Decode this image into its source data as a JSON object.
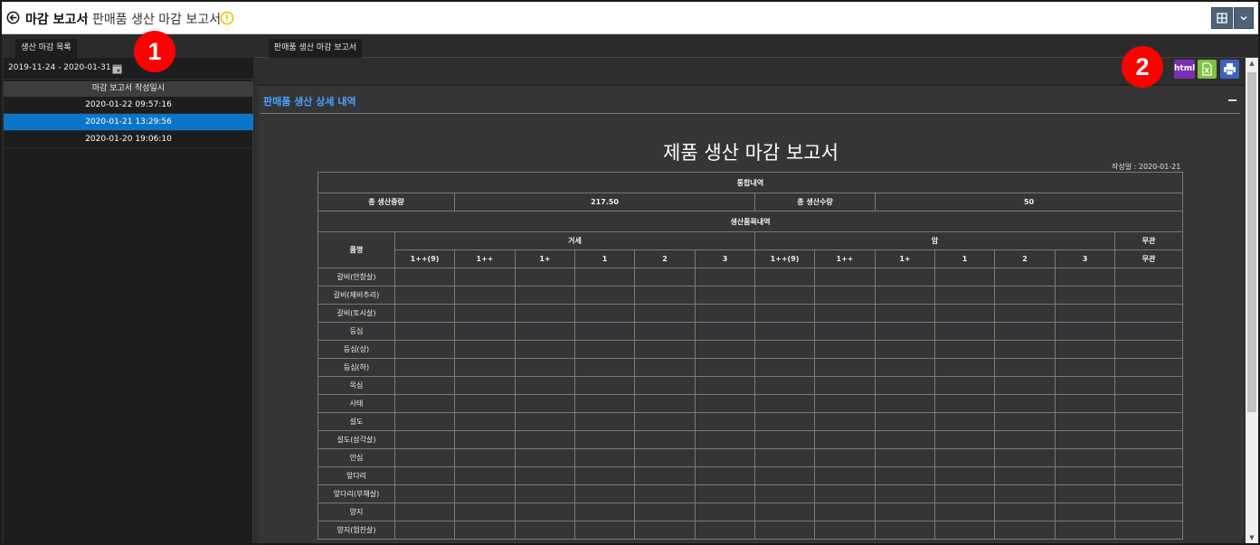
{
  "titlebar": {
    "main": "마감 보고서",
    "separator": "-",
    "sub": "판매품 생산 마감 보고서"
  },
  "left": {
    "tab_label": "생산 마감 목록",
    "date_range": "2019-11-24 - 2020-01-31",
    "list_header": "마감 보고서 작성일시",
    "items": [
      "2020-01-22 09:57:16",
      "2020-01-21 13:29:56",
      "2020-01-20 19:06:10"
    ],
    "selected_index": 1
  },
  "badges": [
    "1",
    "2"
  ],
  "right": {
    "tab_label": "판매품 생산 마감 보고서",
    "export_html_label": "html"
  },
  "report": {
    "section_title": "판매품 생산 상세 내역",
    "title": "제품 생산 마감 보고서",
    "date": "작성일 : 2020-01-21",
    "summary_header": "통합내역",
    "total_weight_label": "총 생산중량",
    "total_weight_value": "217.50",
    "total_count_label": "총 생산수량",
    "total_count_value": "50",
    "items_header": "생산품목내역",
    "product_name_header": "품명",
    "group_castrated": "거세",
    "group_female": "암",
    "group_none": "무관",
    "grades": [
      "1++(9)",
      "1++",
      "1+",
      "1",
      "2",
      "3"
    ],
    "products": [
      "갈비(안창살)",
      "갈비(제비추리)",
      "갈비(토시살)",
      "등심",
      "등심(상)",
      "등심(하)",
      "목심",
      "사태",
      "설도",
      "설도(삼각살)",
      "안심",
      "앞다리",
      "앞다리(부채살)",
      "양지",
      "양지(업진살)"
    ]
  },
  "colors": {
    "selected": "#0b76c9",
    "section_title": "#4aa3ff",
    "badge": "#ff0000",
    "html_button": "#7b2fb0",
    "excel_button": "#7fc241",
    "print_button": "#3c62c0"
  }
}
